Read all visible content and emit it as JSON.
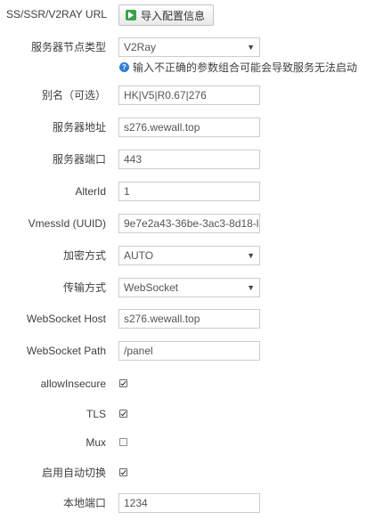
{
  "import": {
    "label": "SS/SSR/V2RAY URL",
    "button_label": "导入配置信息",
    "button_icon": "play-icon"
  },
  "server_type": {
    "label": "服务器节点类型",
    "value": "V2Ray",
    "hint": "输入不正确的参数组合可能会导致服务无法启动"
  },
  "alias": {
    "label": "别名（可选）",
    "value": "HK|V5|R0.67|276"
  },
  "address": {
    "label": "服务器地址",
    "value": "s276.wewall.top"
  },
  "port": {
    "label": "服务器端口",
    "value": "443"
  },
  "alter_id": {
    "label": "AlterId",
    "value": "1"
  },
  "vmess_id": {
    "label": "VmessId (UUID)",
    "value": "9e7e2a43-36be-3ac3-8d18-l"
  },
  "encryption": {
    "label": "加密方式",
    "value": "AUTO"
  },
  "transport": {
    "label": "传输方式",
    "value": "WebSocket"
  },
  "ws_host": {
    "label": "WebSocket Host",
    "value": "s276.wewall.top"
  },
  "ws_path": {
    "label": "WebSocket Path",
    "value": "/panel"
  },
  "allow_insecure": {
    "label": "allowInsecure",
    "checked": true
  },
  "tls": {
    "label": "TLS",
    "checked": true
  },
  "mux": {
    "label": "Mux",
    "checked": false
  },
  "auto_switch": {
    "label": "启用自动切换",
    "checked": true
  },
  "local_port": {
    "label": "本地端口",
    "value": "1234"
  },
  "colors": {
    "hint_icon": "#2f7fd4",
    "button_icon": "#3aa34a"
  }
}
